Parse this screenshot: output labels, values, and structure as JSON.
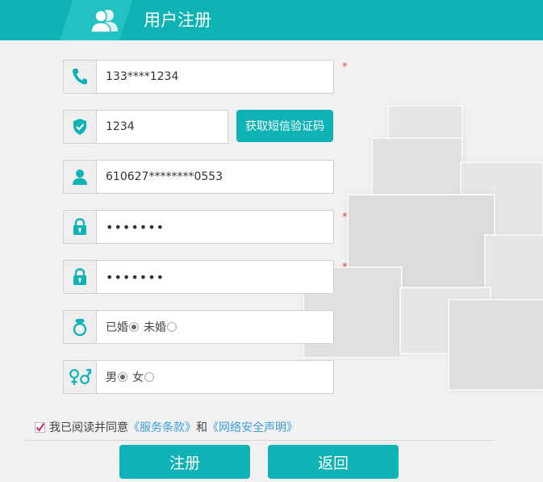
{
  "header": {
    "title": "用户注册",
    "icon": "users-icon"
  },
  "form": {
    "phone": {
      "value": "133****1234",
      "icon": "phone-icon",
      "required_mark": "*"
    },
    "code": {
      "value": "1234",
      "icon": "shield-check-icon",
      "button": "获取短信验证码"
    },
    "id_card": {
      "value": "610627********0553",
      "icon": "user-icon"
    },
    "password": {
      "value": "1234567",
      "icon": "lock-icon",
      "required_mark": "*"
    },
    "confirm_password": {
      "value": "1234567",
      "icon": "lock-icon",
      "required_mark": "*"
    },
    "marital": {
      "icon": "ring-icon",
      "options": [
        {
          "label": "已婚",
          "selected": true
        },
        {
          "label": "未婚",
          "selected": false
        }
      ]
    },
    "gender": {
      "icon": "gender-icon",
      "options": [
        {
          "label": "男",
          "selected": true
        },
        {
          "label": "女",
          "selected": false
        }
      ]
    }
  },
  "agreement": {
    "checked": true,
    "text": "我已阅读并同意",
    "link1": "《服务条款》",
    "and": "和",
    "link2": "《网络安全声明》"
  },
  "buttons": {
    "register": "注册",
    "back": "返回"
  },
  "colors": {
    "accent": "#0fb3b5",
    "required": "#e64343",
    "link": "#3a9edb"
  }
}
